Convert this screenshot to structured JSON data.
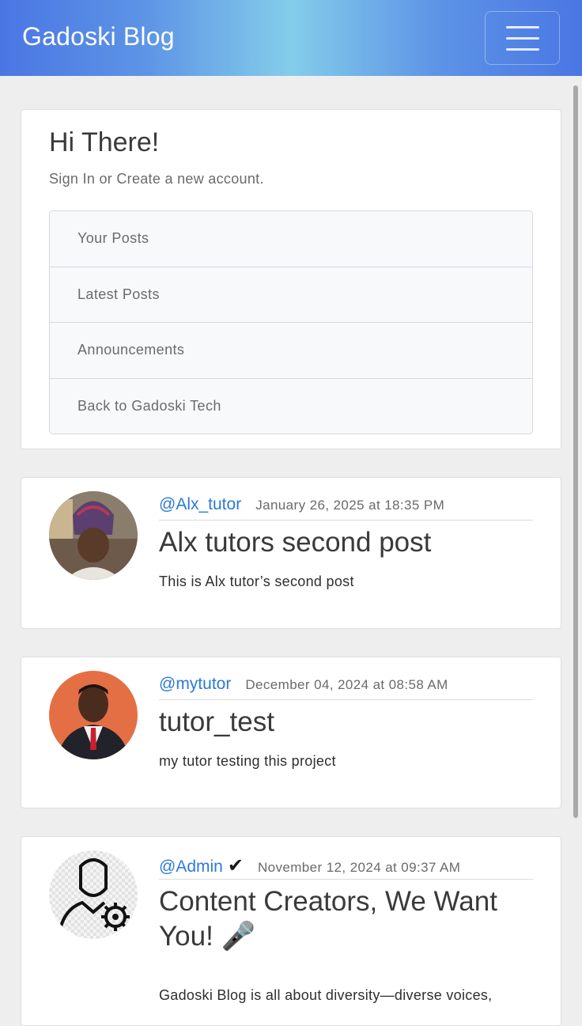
{
  "navbar": {
    "brand": "Gadoski Blog",
    "menu_icon": "hamburger-menu-icon",
    "colors": {
      "gradient_edge": "#4a76e3",
      "gradient_center": "#84cdea"
    }
  },
  "welcome": {
    "heading": "Hi There!",
    "subtitle": "Sign In or Create a new account.",
    "links": [
      {
        "label": "Your Posts"
      },
      {
        "label": "Latest Posts"
      },
      {
        "label": "Announcements"
      },
      {
        "label": "Back to Gadoski Tech"
      }
    ]
  },
  "posts": [
    {
      "author": "@Alx_tutor",
      "date": "January 26, 2025 at 18:35 PM",
      "title": "Alx tutors second post",
      "body": "This is Alx tutor’s second post"
    },
    {
      "author": "@mytutor",
      "date": "December 04, 2024 at 08:58 AM",
      "title": "tutor_test",
      "body": "my tutor testing this project"
    },
    {
      "author": "@Admin",
      "verified_mark": "✔",
      "date": "November 12, 2024 at 09:37 AM",
      "title": "Content Creators, We Want You! 🎤",
      "body": "Gadoski Blog is all about diversity—diverse voices,"
    }
  ],
  "colors": {
    "link": "#2b7ad6",
    "page_bg": "#efeeef"
  }
}
